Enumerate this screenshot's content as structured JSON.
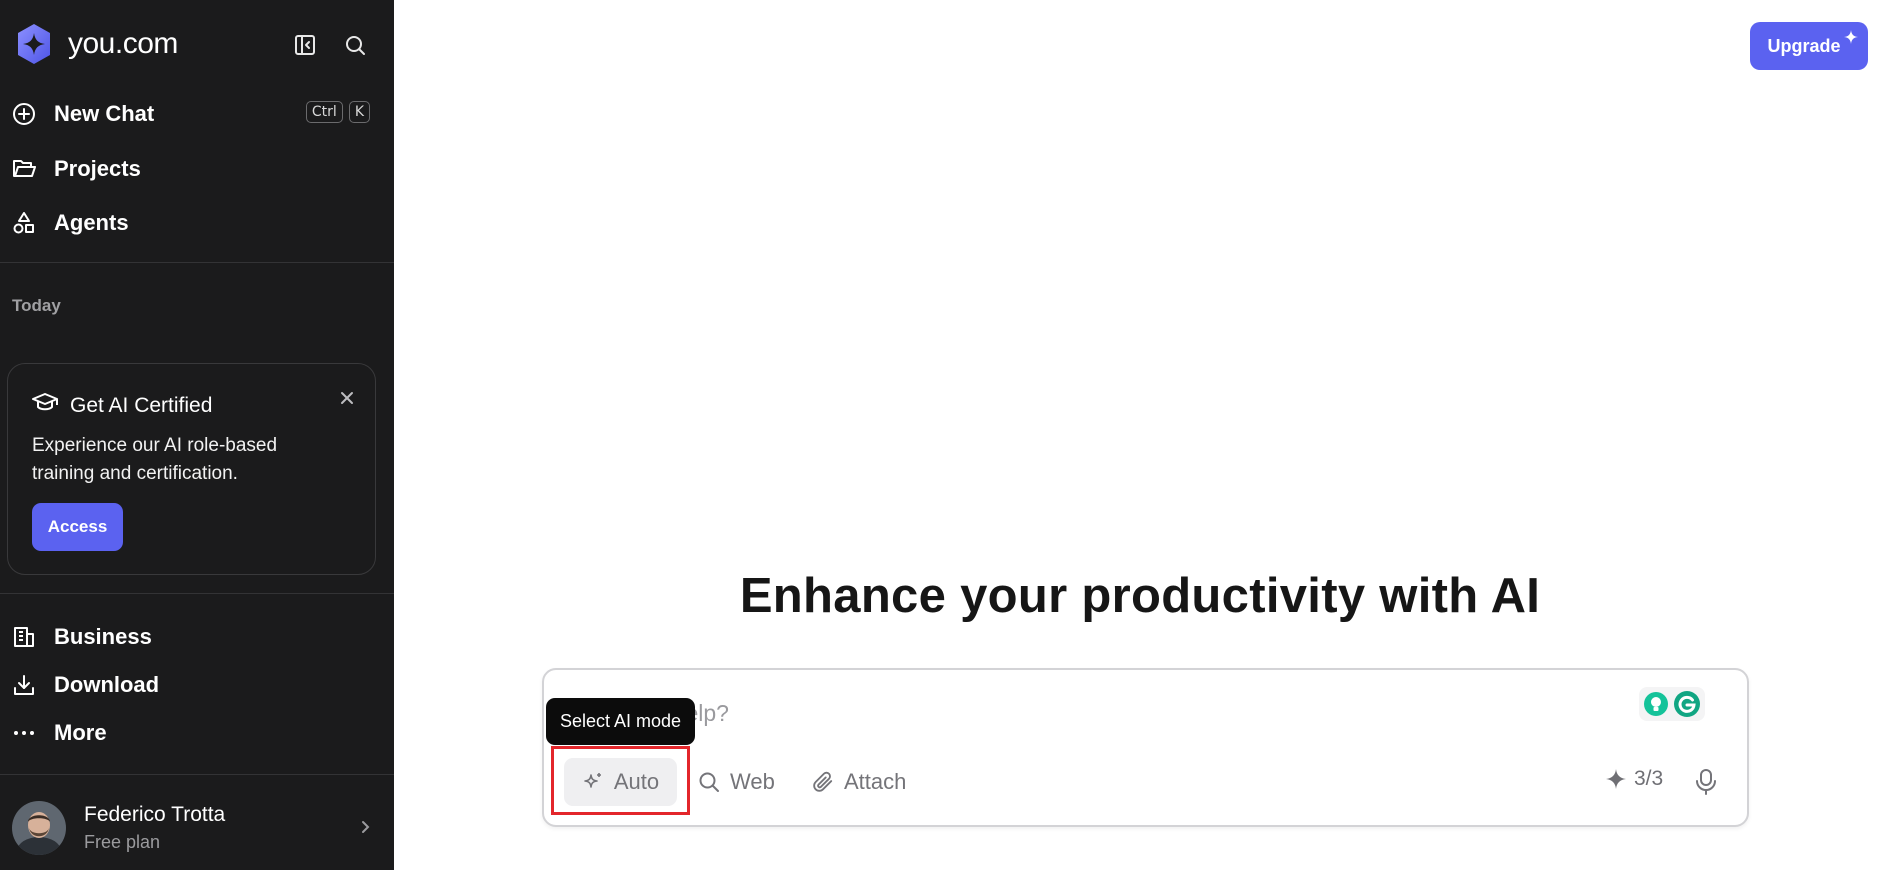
{
  "sidebar": {
    "brand": "you.com",
    "nav": [
      {
        "label": "New Chat",
        "icon": "plus-circle-icon"
      },
      {
        "label": "Projects",
        "icon": "folder-icon"
      },
      {
        "label": "Agents",
        "icon": "shapes-icon"
      }
    ],
    "shortcut": {
      "key1": "Ctrl",
      "key2": "K"
    },
    "section_label": "Today",
    "promo": {
      "title": "Get AI Certified",
      "text": "Experience our AI role-based training and certification.",
      "button": "Access"
    },
    "bottom_nav": [
      {
        "label": "Business",
        "icon": "building-icon"
      },
      {
        "label": "Download",
        "icon": "download-icon"
      },
      {
        "label": "More",
        "icon": "ellipsis-icon"
      }
    ],
    "user": {
      "name": "Federico Trotta",
      "plan": "Free plan"
    }
  },
  "header": {
    "upgrade_label": "Upgrade"
  },
  "main": {
    "headline": "Enhance your productivity with AI",
    "composer": {
      "placeholder": "How can I help?",
      "tooltip": "Select AI mode",
      "mode_label": "Auto",
      "web_label": "Web",
      "attach_label": "Attach",
      "credits": "3/3"
    }
  },
  "colors": {
    "accent": "#5b62f0",
    "sidebar_bg": "#1b1b1c",
    "highlight": "#e3262b"
  }
}
